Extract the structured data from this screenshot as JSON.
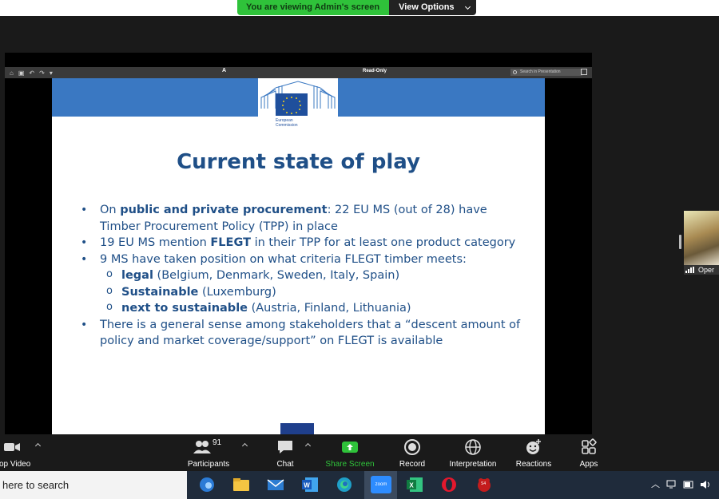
{
  "banner": {
    "viewing_text": "You are viewing Admin's screen",
    "view_options_label": "View Options"
  },
  "ppt_toolbar": {
    "header_text": "A",
    "read_only": "Read-Only",
    "search_placeholder": "Search in Presentation"
  },
  "slide": {
    "logo_text_1": "European",
    "logo_text_2": "Commission",
    "title": "Current state of play",
    "bullets": [
      {
        "pre": "On ",
        "bold": "public and private procurement",
        "post": ": 22 EU MS (out of 28) have Timber Procurement Policy (TPP) in place"
      },
      {
        "pre": "19 EU MS mention ",
        "bold": "FLEGT",
        "post": " in their TPP for at least one product category"
      },
      {
        "pre": "9 MS have taken position on what criteria FLEGT timber meets:",
        "bold": "",
        "post": ""
      }
    ],
    "sub_bullets": [
      {
        "bold": "legal",
        "post": " (Belgium, Denmark, Sweden, Italy, Spain)"
      },
      {
        "bold": "Sustainable",
        "post": " (Luxemburg)"
      },
      {
        "bold": "next to sustainable",
        "post": " (Austria, Finland, Lithuania)"
      }
    ],
    "last_bullet": "There is a general sense among stakeholders that a “descent amount of policy and market coverage/support” on FLEGT is available"
  },
  "participant_thumb": {
    "label": "Oper"
  },
  "zoom_toolbar": {
    "items": [
      {
        "label": "op Video",
        "icon": "video-camera-icon"
      },
      {
        "label": "Participants",
        "icon": "participants-icon",
        "count": "91"
      },
      {
        "label": "Chat",
        "icon": "chat-icon"
      },
      {
        "label": "Share Screen",
        "icon": "share-screen-icon"
      },
      {
        "label": "Record",
        "icon": "record-icon"
      },
      {
        "label": "Interpretation",
        "icon": "globe-icon"
      },
      {
        "label": "Reactions",
        "icon": "reactions-icon"
      },
      {
        "label": "Apps",
        "icon": "apps-icon"
      }
    ],
    "share_color": "#2fc23a"
  },
  "taskbar": {
    "search_text": "here to search",
    "apps": [
      "edge-profile-icon",
      "file-explorer-icon",
      "mail-icon",
      "word-icon",
      "edge-icon",
      "zoom-icon",
      "excel-icon",
      "opera-icon",
      "app-icon"
    ],
    "zoom_app_label": "zoom",
    "red_app_label": "S4"
  }
}
